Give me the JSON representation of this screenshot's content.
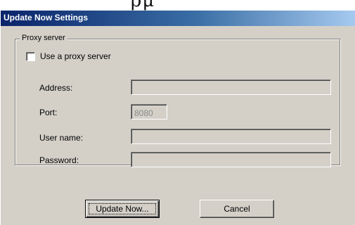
{
  "header_fragment": "ρμ",
  "window": {
    "title": "Update Now Settings"
  },
  "proxy": {
    "group_label": "Proxy server",
    "use_proxy_label": "Use a proxy server",
    "use_proxy_checked": false,
    "address_label": "Address:",
    "address_value": "",
    "port_label": "Port:",
    "port_value": "8080",
    "username_label": "User name:",
    "username_value": "",
    "password_label": "Password:",
    "password_value": ""
  },
  "buttons": {
    "update_now_label": "Update Now...",
    "cancel_label": "Cancel"
  }
}
